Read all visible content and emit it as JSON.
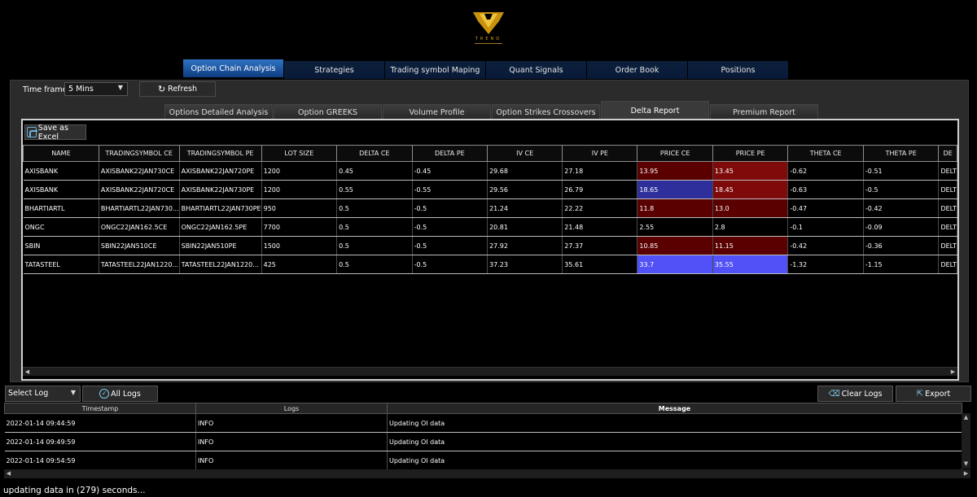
{
  "brand": {
    "name": "TREND"
  },
  "main_tabs": [
    "Option Chain Analysis",
    "Strategies",
    "Trading symbol Maping",
    "Quant Signals",
    "Order Book",
    "Positions"
  ],
  "toolbar": {
    "timeframe_label": "Time frame",
    "timeframe_value": "5 Mins",
    "refresh_label": "Refresh"
  },
  "sub_tabs": [
    "Options Detailed Analysis",
    "Option GREEKS",
    "Volume Profile",
    "Option Strikes Crossovers",
    "Delta Report",
    "Premium Report"
  ],
  "grid": {
    "save_excel_label": "Save as Excel",
    "columns": [
      "NAME",
      "TRADINGSYMBOL CE",
      "TRADINGSYMBOL PE",
      "LOT SIZE",
      "DELTA CE",
      "DELTA PE",
      "IV CE",
      "IV PE",
      "PRICE CE",
      "PRICE PE",
      "THETA CE",
      "THETA PE",
      "DE"
    ],
    "rows": [
      [
        "AXISBANK",
        "AXISBANK22JAN730CE",
        "AXISBANK22JAN720PE",
        "1200",
        "0.45",
        "-0.45",
        "29.68",
        "27.18",
        "13.95",
        "13.45",
        "-0.62",
        "-0.51",
        "DELT"
      ],
      [
        "AXISBANK",
        "AXISBANK22JAN720CE",
        "AXISBANK22JAN730PE",
        "1200",
        "0.55",
        "-0.55",
        "29.56",
        "26.79",
        "18.65",
        "18.45",
        "-0.63",
        "-0.5",
        "DELT"
      ],
      [
        "BHARTIARTL",
        "BHARTIARTL22JAN730...",
        "BHARTIARTL22JAN730PE",
        "950",
        "0.5",
        "-0.5",
        "21.24",
        "22.22",
        "11.8",
        "13.0",
        "-0.47",
        "-0.42",
        "DELT"
      ],
      [
        "ONGC",
        "ONGC22JAN162.5CE",
        "ONGC22JAN162.5PE",
        "7700",
        "0.5",
        "-0.5",
        "20.81",
        "21.48",
        "2.55",
        "2.8",
        "-0.1",
        "-0.09",
        "DELT"
      ],
      [
        "SBIN",
        "SBIN22JAN510CE",
        "SBIN22JAN510PE",
        "1500",
        "0.5",
        "-0.5",
        "27.92",
        "27.37",
        "10.85",
        "11.15",
        "-0.42",
        "-0.36",
        "DELT"
      ],
      [
        "TATASTEEL",
        "TATASTEEL22JAN1220...",
        "TATASTEEL22JAN1220...",
        "425",
        "0.5",
        "-0.5",
        "37.23",
        "35.61",
        "33.7",
        "35.55",
        "-1.32",
        "-1.15",
        "DELT"
      ]
    ],
    "cell_colors": {
      "0": {
        "8": "#5a0000",
        "9": "#7e0a0a"
      },
      "1": {
        "8": "#2f2f9c",
        "9": "#7e0a0a"
      },
      "2": {
        "8": "#5a0000",
        "9": "#5a0000"
      },
      "4": {
        "8": "#5a0000",
        "9": "#5a0000"
      },
      "5": {
        "8": "#5151f7",
        "9": "#5151f7"
      }
    }
  },
  "logs": {
    "select_label": "Select Log",
    "all_logs_label": "All Logs",
    "clear_logs_label": "Clear Logs",
    "export_label": "Export",
    "columns": [
      "Timestamp",
      "Logs",
      "Message"
    ],
    "rows": [
      [
        "2022-01-14 09:44:59",
        "INFO",
        "Updating OI data"
      ],
      [
        "2022-01-14 09:49:59",
        "INFO",
        "Updating OI data"
      ],
      [
        "2022-01-14 09:54:59",
        "INFO",
        "Updating OI data"
      ]
    ]
  },
  "status": {
    "text": "updating data in (279) seconds..."
  }
}
